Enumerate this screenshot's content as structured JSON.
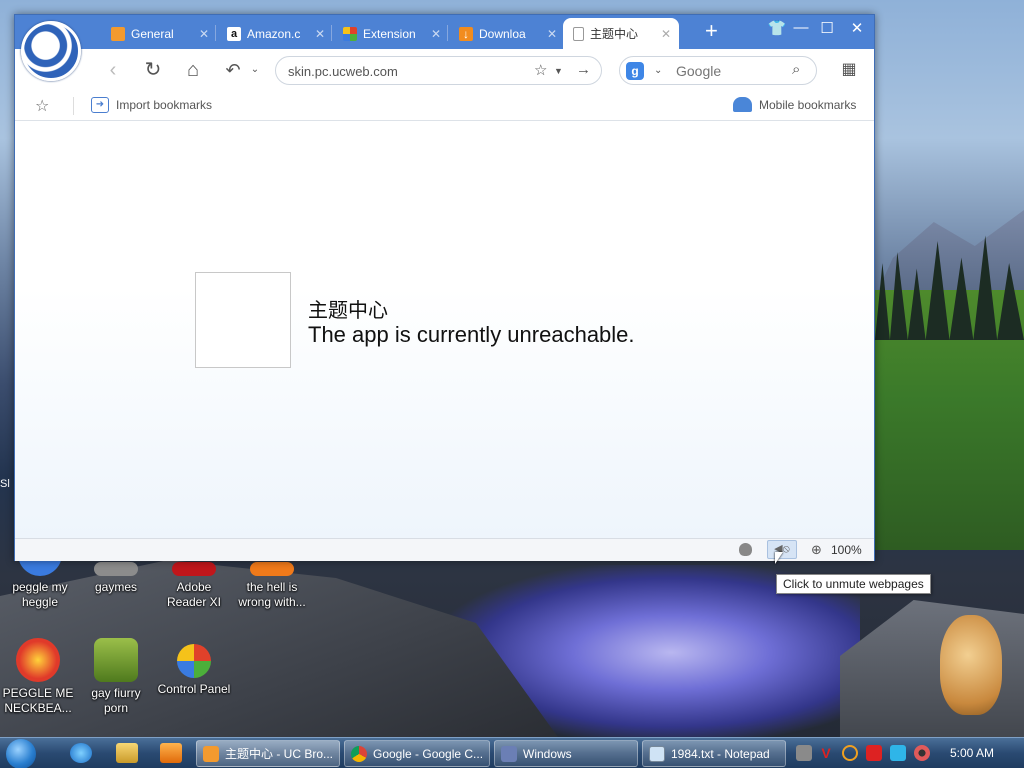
{
  "browser": {
    "tabs": [
      {
        "label": "General",
        "icon": "gear-icon",
        "color": "#f39a2e"
      },
      {
        "label": "Amazon.c",
        "icon": "amazon-icon",
        "color": "#ffffff"
      },
      {
        "label": "Extension",
        "icon": "puzzle-icon",
        "color": "#6fbf4a"
      },
      {
        "label": "Downloa",
        "icon": "download-icon",
        "color": "#f28c1e"
      },
      {
        "label": "主题中心",
        "icon": "page-icon",
        "color": "#ffffff",
        "active": true
      }
    ],
    "window_controls": [
      "skin-icon",
      "minimize-icon",
      "maximize-icon",
      "close-icon"
    ],
    "nav": {
      "url": "skin.pc.ucweb.com",
      "search_placeholder": "Google",
      "search_engine_letter": "g"
    },
    "bookmarks": {
      "import_label": "Import bookmarks",
      "mobile_label": "Mobile bookmarks"
    },
    "page": {
      "title": "主题中心",
      "message": "The app is currently unreachable."
    },
    "status": {
      "zoom": "100%",
      "tooltip": "Click to unmute webpages"
    }
  },
  "desktop": {
    "left_edge_text": "Sl",
    "icons": [
      {
        "label": "peggle my heggle",
        "color": "#3a7be0"
      },
      {
        "label": "gaymes",
        "color": "#8c8c8c"
      },
      {
        "label": "Adobe Reader XI",
        "color": "#c0161b"
      },
      {
        "label": "the hell is wrong with...",
        "color": "#f07a1a"
      },
      {
        "label": "PEGGLE ME NECKBEA...",
        "color": "#e03a2a"
      },
      {
        "label": "gay fiurry porn",
        "color": "#6b9a2a"
      },
      {
        "label": "Control Panel",
        "color": "#3aa0d8"
      }
    ]
  },
  "taskbar": {
    "buttons": [
      {
        "label": "主题中心 - UC Bro...",
        "color": "#f39a2e"
      },
      {
        "label": "Google - Google C...",
        "color": "#db4437"
      },
      {
        "label": "Windows",
        "color": "#6b7fb5"
      },
      {
        "label": "1984.txt - Notepad",
        "color": "#cfe3f5"
      }
    ],
    "time": "5:00 AM"
  }
}
